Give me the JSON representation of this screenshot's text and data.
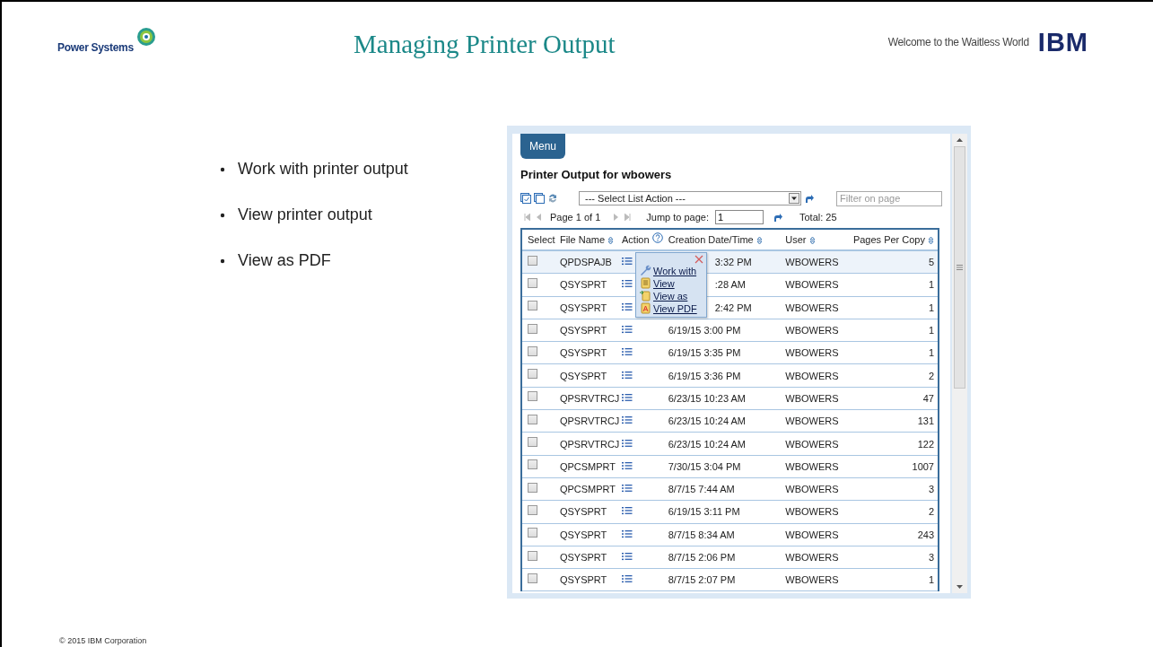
{
  "slide": {
    "brand": "Power Systems",
    "title": "Managing Printer Output",
    "tagline": "Welcome to the Waitless World",
    "logo": "IBM",
    "bullets": [
      "Work with printer output",
      "View printer output",
      "View as PDF"
    ],
    "footer": "© 2015 IBM Corporation"
  },
  "app": {
    "menu_button": "Menu",
    "heading": "Printer Output for wbowers",
    "list_action": {
      "value": "--- Select List Action ---"
    },
    "filter": {
      "placeholder": "Filter on page"
    },
    "pager": {
      "page": "Page 1 of 1",
      "jump_label": "Jump to page:",
      "jump_value": "1",
      "total": "Total: 25"
    },
    "columns": [
      {
        "label": "Select",
        "kind": "plain"
      },
      {
        "label": "File Name",
        "kind": "sort"
      },
      {
        "label": "Action",
        "kind": "help"
      },
      {
        "label": "Creation Date/Time",
        "kind": "sort"
      },
      {
        "label": "User",
        "kind": "sort"
      },
      {
        "label": "Pages Per Copy",
        "kind": "sort"
      }
    ],
    "rows": [
      {
        "file_name": "QPDSPAJB",
        "date": "3:32 PM",
        "user": "WBOWERS",
        "pages": "5",
        "checked": false,
        "selected": true
      },
      {
        "file_name": "QSYSPRT",
        "date": ":28 AM",
        "user": "WBOWERS",
        "pages": "1",
        "checked": false,
        "selected": false
      },
      {
        "file_name": "QSYSPRT",
        "date": "2:42 PM",
        "user": "WBOWERS",
        "pages": "1",
        "checked": false,
        "selected": false
      },
      {
        "file_name": "QSYSPRT",
        "date": "6/19/15 3:00 PM",
        "user": "WBOWERS",
        "pages": "1",
        "checked": false,
        "selected": false
      },
      {
        "file_name": "QSYSPRT",
        "date": "6/19/15 3:35 PM",
        "user": "WBOWERS",
        "pages": "1",
        "checked": false,
        "selected": false
      },
      {
        "file_name": "QSYSPRT",
        "date": "6/19/15 3:36 PM",
        "user": "WBOWERS",
        "pages": "2",
        "checked": false,
        "selected": false
      },
      {
        "file_name": "QPSRVTRCJ",
        "date": "6/23/15 10:23 AM",
        "user": "WBOWERS",
        "pages": "47",
        "checked": false,
        "selected": false
      },
      {
        "file_name": "QPSRVTRCJ",
        "date": "6/23/15 10:24 AM",
        "user": "WBOWERS",
        "pages": "131",
        "checked": false,
        "selected": false
      },
      {
        "file_name": "QPSRVTRCJ",
        "date": "6/23/15 10:24 AM",
        "user": "WBOWERS",
        "pages": "122",
        "checked": false,
        "selected": false
      },
      {
        "file_name": "QPCSMPRT",
        "date": "7/30/15 3:04 PM",
        "user": "WBOWERS",
        "pages": "1007",
        "checked": false,
        "selected": false
      },
      {
        "file_name": "QPCSMPRT",
        "date": "8/7/15 7:44 AM",
        "user": "WBOWERS",
        "pages": "3",
        "checked": false,
        "selected": false
      },
      {
        "file_name": "QSYSPRT",
        "date": "6/19/15 3:11 PM",
        "user": "WBOWERS",
        "pages": "2",
        "checked": false,
        "selected": false
      },
      {
        "file_name": "QSYSPRT",
        "date": "8/7/15 8:34 AM",
        "user": "WBOWERS",
        "pages": "243",
        "checked": false,
        "selected": false
      },
      {
        "file_name": "QSYSPRT",
        "date": "8/7/15 2:06 PM",
        "user": "WBOWERS",
        "pages": "3",
        "checked": false,
        "selected": false
      },
      {
        "file_name": "QSYSPRT",
        "date": "8/7/15 2:07 PM",
        "user": "WBOWERS",
        "pages": "1",
        "checked": false,
        "selected": false
      }
    ],
    "popup": {
      "items": [
        {
          "label": "Work with",
          "kind": "wrench"
        },
        {
          "label": "View",
          "kind": "page"
        },
        {
          "label": "View as",
          "kind": "page-arrow"
        },
        {
          "label": "View PDF",
          "kind": "pdf"
        }
      ]
    }
  }
}
